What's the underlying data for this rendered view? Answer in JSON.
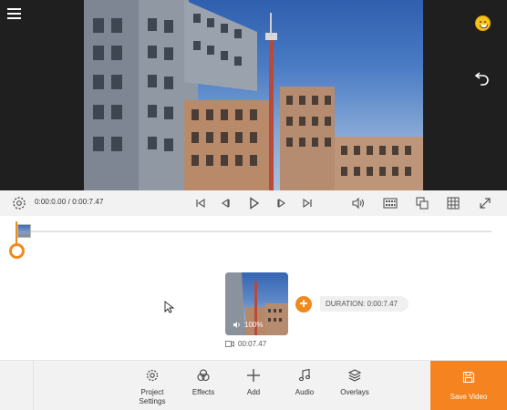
{
  "preview": {
    "menu_icon": "hamburger-icon",
    "emoji_icon": "smiley-emoji-icon",
    "undo_icon": "undo-icon"
  },
  "playback": {
    "timecode": "0:00:0.00 / 0:00:7.47",
    "icons": [
      "settings-gear-icon",
      "skip-to-start-icon",
      "step-back-icon",
      "play-icon",
      "step-forward-icon",
      "skip-to-end-icon",
      "volume-icon",
      "aspect-ratio-icon",
      "resize-icon",
      "grid-icon",
      "fullscreen-icon"
    ]
  },
  "timeline": {
    "clip": {
      "volume": "100%",
      "duration": "00:07.47"
    },
    "add_icon": "+",
    "duration_label": "DURATION: 0:00:7.47"
  },
  "toolbar": {
    "project_settings": "Project Settings",
    "effects": "Effects",
    "add": "Add",
    "audio": "Audio",
    "overlays": "Overlays",
    "save": "Save Video"
  },
  "colors": {
    "accent": "#f5831f",
    "preview_bg": "#1f1f1f",
    "toolbar_bg": "#f2f2f2"
  }
}
